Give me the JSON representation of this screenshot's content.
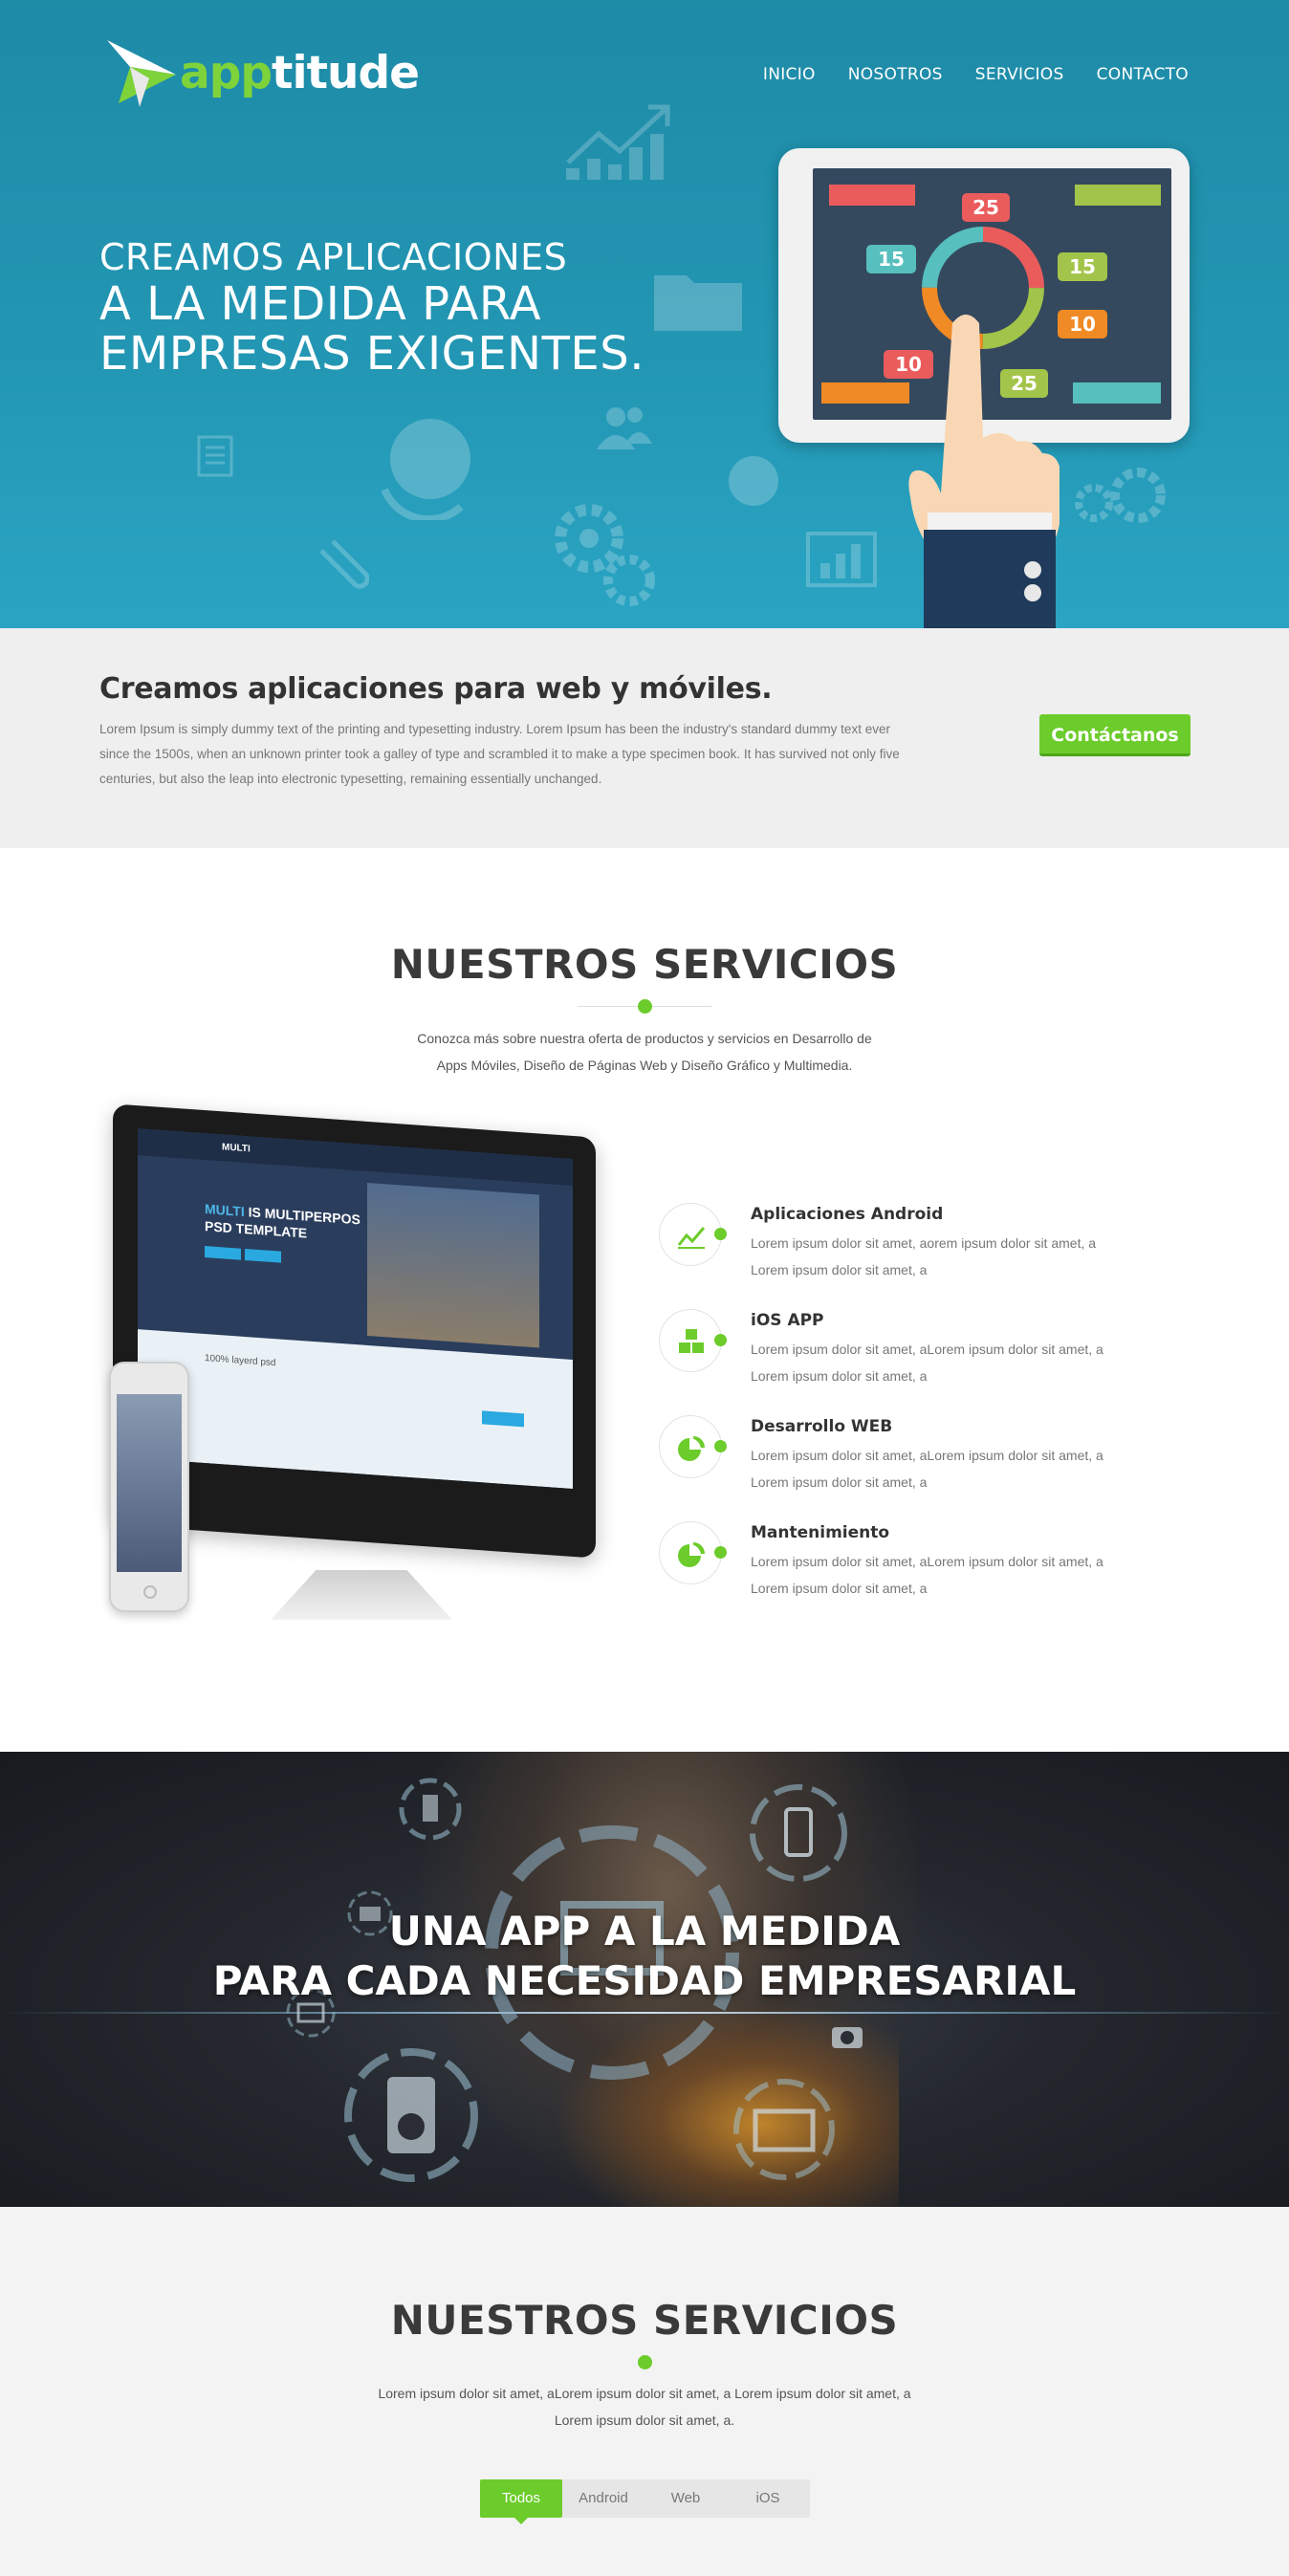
{
  "brand": {
    "part1": "app",
    "part2": "titude"
  },
  "nav": {
    "items": [
      "INICIO",
      "NOSOTROS",
      "SERVICIOS",
      "CONTACTO"
    ]
  },
  "hero": {
    "line1": "CREAMOS APLICACIONES",
    "line2": "A LA MEDIDA PARA",
    "line3": "EMPRESAS EXIGENTES.",
    "tablet_numbers": [
      "25",
      "15",
      "15",
      "10",
      "10",
      "25"
    ]
  },
  "intro": {
    "heading": "Creamos aplicaciones para web y móviles.",
    "body": "Lorem Ipsum is simply dummy text of the printing and typesetting industry. Lorem Ipsum has been the industry's standard dummy text ever since the 1500s, when an unknown printer took a galley of type and scrambled it to make a type specimen book. It has survived not only five centuries, but also the leap into electronic typesetting, remaining essentially unchanged.",
    "cta": "Contáctanos"
  },
  "services": {
    "title": "NUESTROS SERVICIOS",
    "subtitle_l1": "Conozca más sobre nuestra oferta de productos y servicios en Desarrollo de",
    "subtitle_l2": "Apps Móviles, Diseño de Páginas Web y Diseño Gráfico y Multimedia.",
    "mockup": {
      "brand": "MULTI",
      "headline_a": "MULTI",
      "headline_b": " IS MULTIPERPOS",
      "headline_c": "PSD TEMPLATE",
      "section": "100% layerd psd"
    },
    "items": [
      {
        "title": "Aplicaciones Android",
        "l1": "Lorem ipsum dolor sit amet, aorem ipsum dolor sit amet, a",
        "l2": "Lorem ipsum dolor sit amet, a",
        "icon": "chart-icon"
      },
      {
        "title": "iOS APP",
        "l1": "Lorem ipsum dolor sit amet, aLorem ipsum dolor sit amet, a",
        "l2": "Lorem ipsum dolor sit amet, a",
        "icon": "cubes-icon"
      },
      {
        "title": "Desarrollo WEB",
        "l1": "Lorem ipsum dolor sit amet, aLorem ipsum dolor sit amet, a",
        "l2": "Lorem ipsum dolor sit amet, a",
        "icon": "pie-chart-icon"
      },
      {
        "title": "Mantenimiento",
        "l1": "Lorem ipsum dolor sit amet, aLorem ipsum dolor sit amet, a",
        "l2": "Lorem ipsum dolor sit amet, a",
        "icon": "pie-chart-icon"
      }
    ]
  },
  "banner": {
    "line1": "UNA APP A LA MEDIDA",
    "line2": "PARA CADA NECESIDAD EMPRESARIAL"
  },
  "portfolio": {
    "title": "NUESTROS SERVICIOS",
    "subtitle_l1": "Lorem ipsum dolor sit amet, aLorem ipsum dolor sit amet, a Lorem ipsum dolor sit amet, a",
    "subtitle_l2": "Lorem ipsum dolor sit amet, a.",
    "tabs": [
      "Todos",
      "Android",
      "Web",
      "iOS"
    ],
    "active_tab": "Todos"
  },
  "colors": {
    "accent": "#6ccc2b",
    "hero_bg": "#2296b3",
    "text_dark": "#333333"
  }
}
